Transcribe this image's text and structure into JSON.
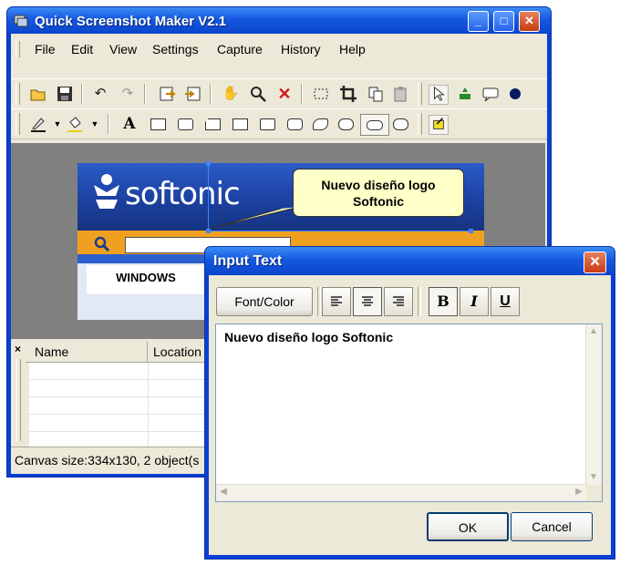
{
  "window": {
    "title": "Quick Screenshot Maker V2.1",
    "buttons": {
      "minimize": "_",
      "maximize": "□",
      "close": "✕"
    }
  },
  "menu": {
    "items": [
      {
        "label": "File"
      },
      {
        "label": "Edit"
      },
      {
        "label": "View"
      },
      {
        "label": "Settings"
      },
      {
        "label": "Capture"
      },
      {
        "label": "History"
      },
      {
        "label": "Help"
      }
    ]
  },
  "toolbar1": {
    "icons": [
      "open-icon",
      "save-icon",
      "undo-icon",
      "redo-icon",
      "export-icon",
      "import-icon",
      "hand-icon",
      "zoom-icon",
      "delete-icon",
      "select-rect-icon",
      "crop-icon",
      "copy-icon",
      "paste-icon",
      "pointer-icon",
      "stamp-icon",
      "callout-icon",
      "circle-icon"
    ]
  },
  "toolbar2": {
    "text_tool": "A"
  },
  "canvas": {
    "logo_text": "softonic",
    "nav_tab": "WINDOWS",
    "balloon_line1": "Nuevo diseño logo",
    "balloon_line2": "Softonic"
  },
  "objects_panel": {
    "close": "×",
    "columns": [
      "Name",
      "Location"
    ],
    "rows": []
  },
  "status": {
    "text": "Canvas size:334x130, 2 object(s"
  },
  "dialog": {
    "title": "Input Text",
    "close": "✕",
    "font_color_label": "Font/Color",
    "bold": "B",
    "italic": "I",
    "underline": "U",
    "text_value": "Nuevo diseño logo Softonic",
    "ok_label": "OK",
    "cancel_label": "Cancel"
  },
  "colors": {
    "title_blue": "#0b44cc",
    "balloon_yellow": "#ffffc8",
    "close_red": "#c63c12"
  }
}
